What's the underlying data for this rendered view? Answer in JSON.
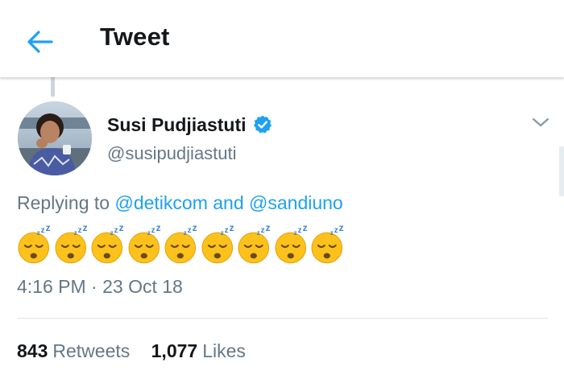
{
  "header": {
    "title": "Tweet",
    "back_icon": "arrow-left-icon"
  },
  "author": {
    "display_name": "Susi Pudjiastuti",
    "handle": "@susipudjiastuti",
    "verified_icon": "verified-badge-icon"
  },
  "tweet": {
    "reply_prefix": "Replying to",
    "reply_mentions": [
      "@detikcom",
      "@sandiuno"
    ],
    "reply_join": "and",
    "emoji_name": "sleeping-face-emoji",
    "emoji_count": 9,
    "timestamp": "4:16 PM · 23 Oct 18"
  },
  "stats": {
    "retweets_count": "843",
    "retweets_label": "Retweets",
    "likes_count": "1,077",
    "likes_label": "Likes"
  },
  "colors": {
    "accent": "#1da1f2",
    "text_primary": "#14171a",
    "text_secondary": "#657786",
    "divider": "#dfe5ea",
    "emoji_yellow": "#fcc21b"
  }
}
